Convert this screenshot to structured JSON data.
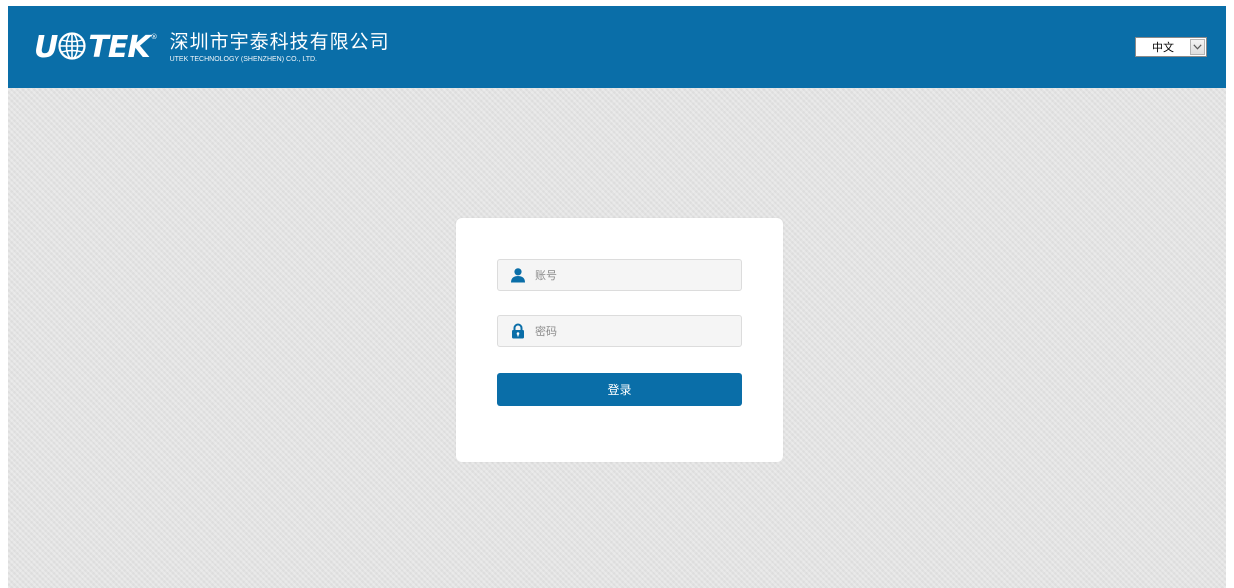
{
  "colors": {
    "header_bg": "#0a6ea8",
    "page_bg": "#e3e3e3",
    "accent": "#0a6ea8",
    "card_bg": "#ffffff"
  },
  "header": {
    "logo": {
      "brand_mark": "U⊕TEK",
      "letters_left": "U",
      "letters_right": "TEK",
      "icon": "globe-icon"
    },
    "company_name_cn": "深圳市宇泰科技有限公司",
    "company_name_en": "UTEK TECHNOLOGY (SHENZHEN) CO., LTD."
  },
  "language_select": {
    "selected": "中文",
    "icon": "chevron-down-icon"
  },
  "login": {
    "username": {
      "placeholder": "账号",
      "value": "",
      "icon": "user-icon"
    },
    "password": {
      "placeholder": "密码",
      "value": "",
      "icon": "lock-icon"
    },
    "submit_label": "登录"
  }
}
